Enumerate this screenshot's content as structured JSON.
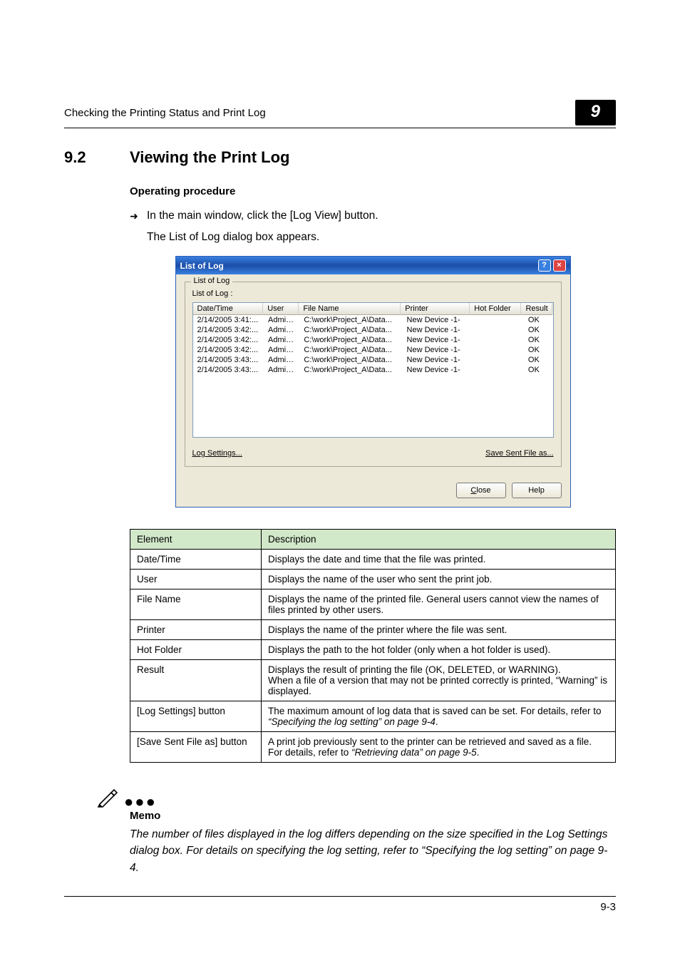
{
  "running_head": {
    "left": "Checking the Printing Status and Print Log",
    "badge": "9"
  },
  "section": {
    "number": "9.2",
    "title": "Viewing the Print Log"
  },
  "op_proc_heading": "Operating procedure",
  "step": {
    "line1": "In the main window, click the [Log View] button.",
    "line2": "The List of Log dialog box appears."
  },
  "dialog": {
    "title": "List of Log",
    "group_legend": "List of Log",
    "group_caption": "List of Log :",
    "columns": {
      "datetime": "Date/Time",
      "user": "User",
      "filename": "File Name",
      "printer": "Printer",
      "hotfolder": "Hot Folder",
      "result": "Result"
    },
    "rows": [
      {
        "dt": "2/14/2005 3:41:...",
        "user": "Admini...",
        "file": "C:\\work\\Project_A\\Data...",
        "prn": "New Device -1-",
        "hot": "",
        "res": "OK"
      },
      {
        "dt": "2/14/2005 3:42:...",
        "user": "Admini...",
        "file": "C:\\work\\Project_A\\Data...",
        "prn": "New Device -1-",
        "hot": "",
        "res": "OK"
      },
      {
        "dt": "2/14/2005 3:42:...",
        "user": "Admini...",
        "file": "C:\\work\\Project_A\\Data...",
        "prn": "New Device -1-",
        "hot": "",
        "res": "OK"
      },
      {
        "dt": "2/14/2005 3:42:...",
        "user": "Admini...",
        "file": "C:\\work\\Project_A\\Data...",
        "prn": "New Device -1-",
        "hot": "",
        "res": "OK"
      },
      {
        "dt": "2/14/2005 3:43:...",
        "user": "Admini...",
        "file": "C:\\work\\Project_A\\Data...",
        "prn": "New Device -1-",
        "hot": "",
        "res": "OK"
      },
      {
        "dt": "2/14/2005 3:43:...",
        "user": "Admini...",
        "file": "C:\\work\\Project_A\\Data...",
        "prn": "New Device -1-",
        "hot": "",
        "res": "OK"
      }
    ],
    "links": {
      "log_settings": "Log Settings...",
      "save_sent": "Save Sent File as..."
    },
    "buttons": {
      "close": "Close",
      "help": "Help"
    }
  },
  "table": {
    "head_element": "Element",
    "head_description": "Description",
    "rows": [
      {
        "el": "Date/Time",
        "desc": "Displays the date and time that the file was printed."
      },
      {
        "el": "User",
        "desc": "Displays the name of the user who sent the print job."
      },
      {
        "el": "File Name",
        "desc": "Displays the name of the printed file. General users cannot view the names of files printed by other users."
      },
      {
        "el": "Printer",
        "desc": "Displays the name of the printer where the file was sent."
      },
      {
        "el": "Hot Folder",
        "desc": "Displays the path to the hot folder (only when a hot folder is used)."
      },
      {
        "el": "Result",
        "desc": "Displays the result of printing the file (OK, DELETED, or WARNING).\nWhen a file of a version that may not be printed correctly is printed, “Warning” is displayed."
      },
      {
        "el": "[Log Settings] button",
        "desc_pre": "The maximum amount of log data that is saved can be set. For details, refer to ",
        "desc_link": "“Specifying the log setting” on page 9-4",
        "desc_post": "."
      },
      {
        "el": "[Save Sent File as] button",
        "desc_pre": "A print job previously sent to the printer can be retrieved and saved as a file.\nFor details, refer to ",
        "desc_link": "“Retrieving data” on page 9-5",
        "desc_post": "."
      }
    ]
  },
  "memo": {
    "title": "Memo",
    "body_pre": "The number of files displayed in the log differs depending on the size specified in the Log Settings dialog box. For details on specifying the log setting, refer to “Specifying the log setting” on page 9-4."
  },
  "footer": {
    "pagenum": "9-3"
  }
}
